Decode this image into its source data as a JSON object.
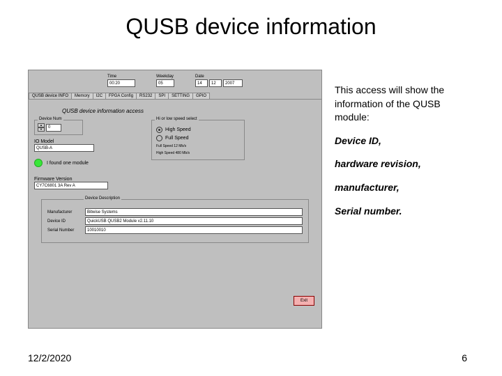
{
  "title": "QUSB device information",
  "app": {
    "top": {
      "time_lbl": "Time",
      "time_val": "00:20",
      "weekday_lbl": "Weekday",
      "weekday_val": "05",
      "date_lbl": "Date",
      "date_d": "14",
      "date_m": "12",
      "date_y": "2007"
    },
    "tabs": [
      "QUSB device INFO",
      "Memory",
      "I2C",
      "FPGA Config",
      "RS232",
      "SPI",
      "SETTING",
      "GPIO"
    ],
    "panel_title": "QUSB device information access",
    "devnum": {
      "label": "Device Num",
      "value": "0"
    },
    "iomodel": {
      "label": "IO Model",
      "value": "QUSB-A"
    },
    "status_lbl": "I found one module",
    "firmware": {
      "label": "Firmware Version",
      "value": "CY7C6801 3A Rev A"
    },
    "speedgrp": {
      "caption": "Hi   or low speed select",
      "opt1": "High Speed",
      "opt2": "Full Speed",
      "note1": "Full    Speed   12    Mb/s",
      "note2": "High   Speed   480   Mb/s"
    },
    "desc": {
      "caption": "Device Description",
      "rows": [
        {
          "label": "Manufacturer",
          "value": "Bitwise Systems"
        },
        {
          "label": "Device ID",
          "value": "QuickUSB QUSB2 Module v2.11.10"
        },
        {
          "label": "Serial Number",
          "value": "10010010"
        }
      ]
    },
    "exit": "Exit"
  },
  "notes": {
    "intro": " This access will show the information of the QUSB module:",
    "l1": "Device ID,",
    "l2": "hardware revision,",
    "l3": "manufacturer,",
    "l4": "Serial number."
  },
  "footer": {
    "date": "12/2/2020",
    "page": "6"
  }
}
